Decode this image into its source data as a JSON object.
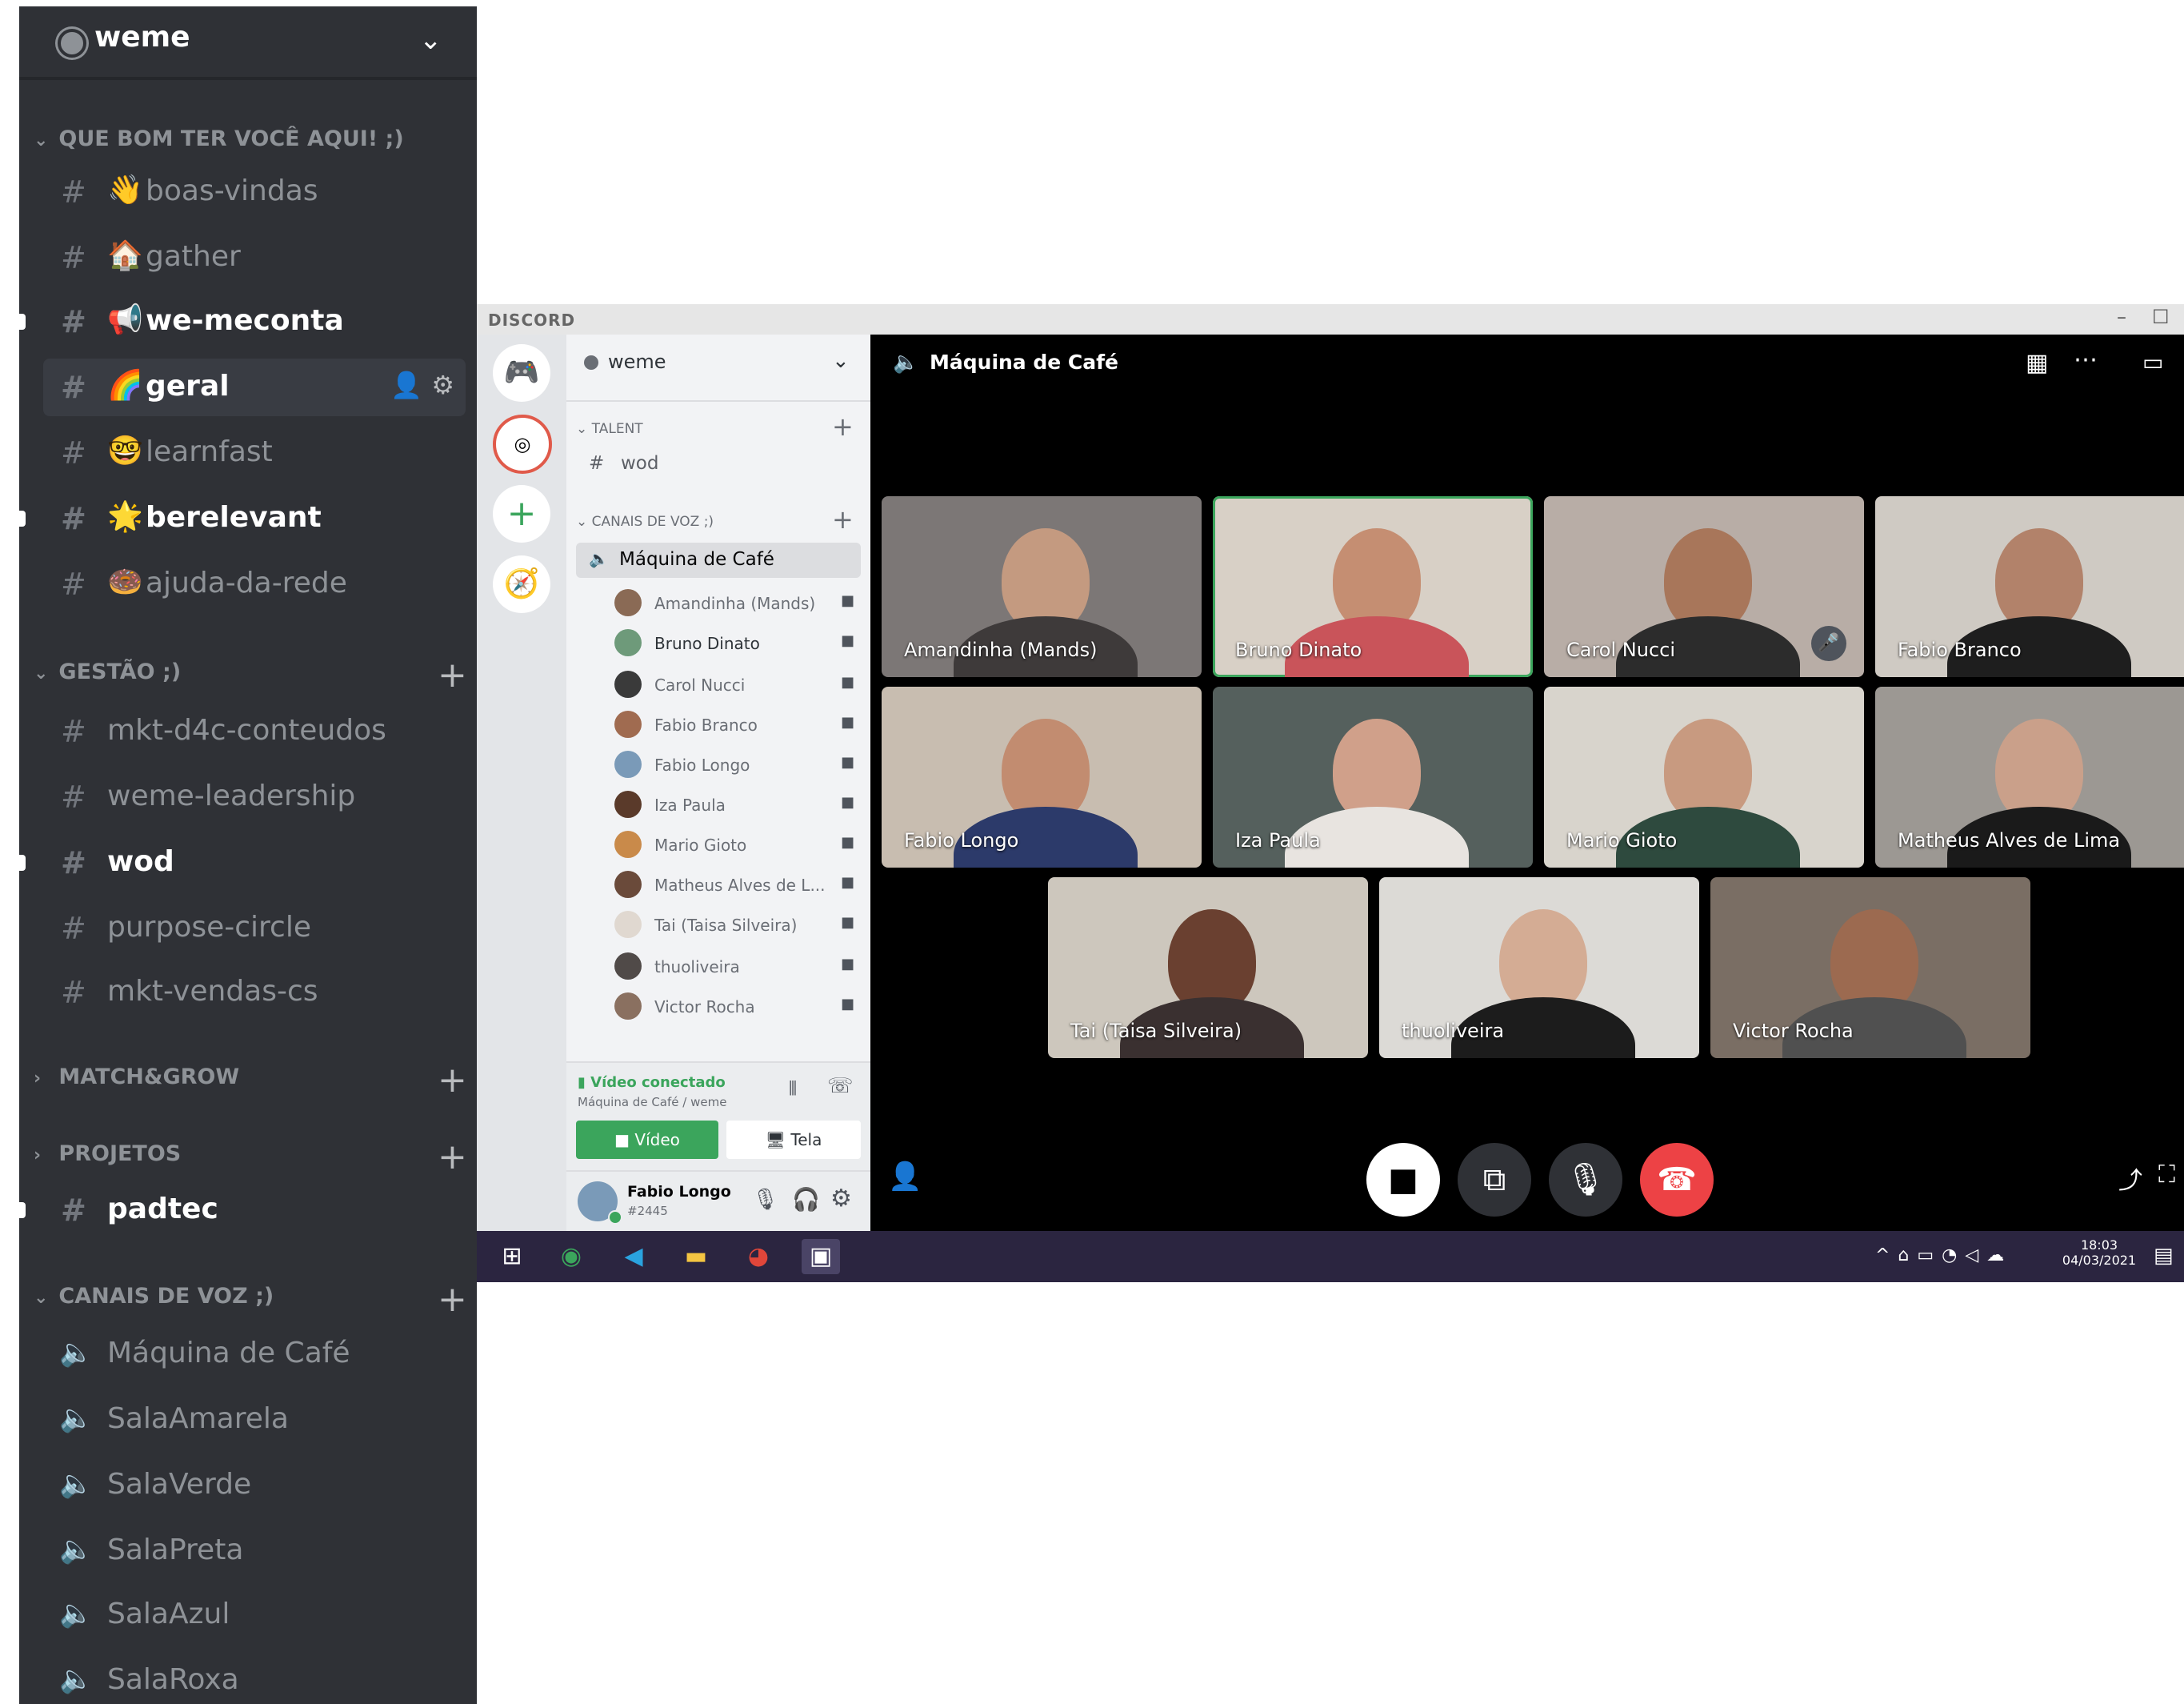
{
  "server": {
    "name": "weme",
    "chevron_icon": "chevron-down-icon"
  },
  "big_sidebar": {
    "categories": [
      {
        "label": "QUE BOM TER VOCÊ AQUI! ;)",
        "collapsed": false
      },
      {
        "label": "GESTÃO ;)",
        "collapsed": false
      },
      {
        "label": "MATCH&GROW",
        "collapsed": true
      },
      {
        "label": "PROJETOS",
        "collapsed": true
      },
      {
        "label": "CANAIS DE VOZ ;)",
        "collapsed": false
      }
    ],
    "channels": [
      {
        "emoji": "👋",
        "label": "boas-vindas"
      },
      {
        "emoji": "🏠",
        "label": "gather"
      },
      {
        "emoji": "📢",
        "label": "we-meconta"
      },
      {
        "emoji": "🌈",
        "label": "geral"
      },
      {
        "emoji": "🤓",
        "label": "learnfast"
      },
      {
        "emoji": "🌟",
        "label": "berelevant"
      },
      {
        "emoji": "🍩",
        "label": "ajuda-da-rede"
      },
      {
        "label": "mkt-d4c-conteudos"
      },
      {
        "label": "weme-leadership"
      },
      {
        "label": "wod"
      },
      {
        "label": "purpose-circle"
      },
      {
        "label": "mkt-vendas-cs"
      },
      {
        "label": "padtec"
      }
    ],
    "voice_channels": [
      "Máquina de Café",
      "SalaAmarela",
      "SalaVerde",
      "SalaPreta",
      "SalaAzul",
      "SalaRoxa"
    ]
  },
  "window": {
    "brand": "DISCORD",
    "server_name": "weme",
    "small_categories": [
      "TALENT",
      "CANAIS DE VOZ ;)"
    ],
    "talent_channel": "wod",
    "voice_channel": "Máquina de Café",
    "members": [
      "Amandinha (Mands)",
      "Bruno Dinato",
      "Carol Nucci",
      "Fabio Branco",
      "Fabio Longo",
      "Iza Paula",
      "Mario Gioto",
      "Matheus Alves de L...",
      "Tai (Taisa Silveira)",
      "thuoliveira",
      "Victor Rocha"
    ],
    "voice_status": "Vídeo conectado",
    "voice_location": "Máquina de Café / weme",
    "video_button": "Vídeo",
    "screen_button": "Tela",
    "user": {
      "name": "Fabio Longo",
      "tag": "#2445"
    },
    "call_title": "Máquina de Café",
    "tiles": [
      "Amandinha (Mands)",
      "Bruno Dinato",
      "Carol Nucci",
      "Fabio Branco",
      "Fabio Longo",
      "Iza Paula",
      "Mario Gioto",
      "Matheus Alves de Lima",
      "Tai (Taisa Silveira)",
      "thuoliveira",
      "Victor Rocha"
    ],
    "taskbar": {
      "time": "18:03",
      "date": "04/03/2021"
    },
    "colors": {
      "sidebar_dark": "#2f3136",
      "call_bg": "#000000",
      "green": "#3ba55c",
      "hangup": "#ed4245",
      "taskbar": "#2b2540"
    }
  }
}
